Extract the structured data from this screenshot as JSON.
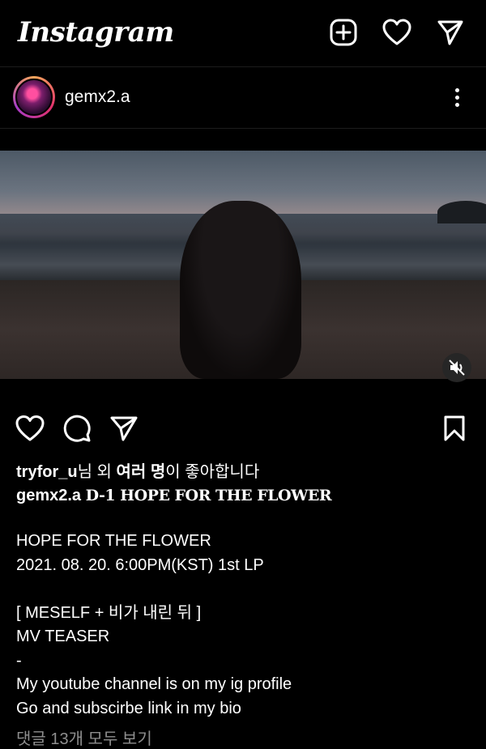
{
  "topbar": {
    "logo": "Instagram",
    "icons": [
      "new-post-icon",
      "heart-icon",
      "direct-message-icon"
    ]
  },
  "post": {
    "username": "gemx2.a",
    "media": {
      "type": "video",
      "muted": true
    },
    "likes": {
      "user": "tryfor_u",
      "suffix": "님 외 ",
      "others": "여러 명",
      "end": "이 좋아합니다"
    },
    "caption": {
      "username": "gemx2.a",
      "title": "D-1 HOPE FOR THE FLOWER"
    },
    "body": [
      "HOPE FOR THE FLOWER",
      "2021. 08. 20. 6:00PM(KST) 1st LP",
      "",
      "[ MESELF + 비가 내린 뒤 ]",
      "MV TEASER",
      "-",
      "My youtube channel is on my ig profile",
      "Go and subscirbe  link in my bio"
    ],
    "comments_link": "댓글 13개 모두 보기"
  }
}
